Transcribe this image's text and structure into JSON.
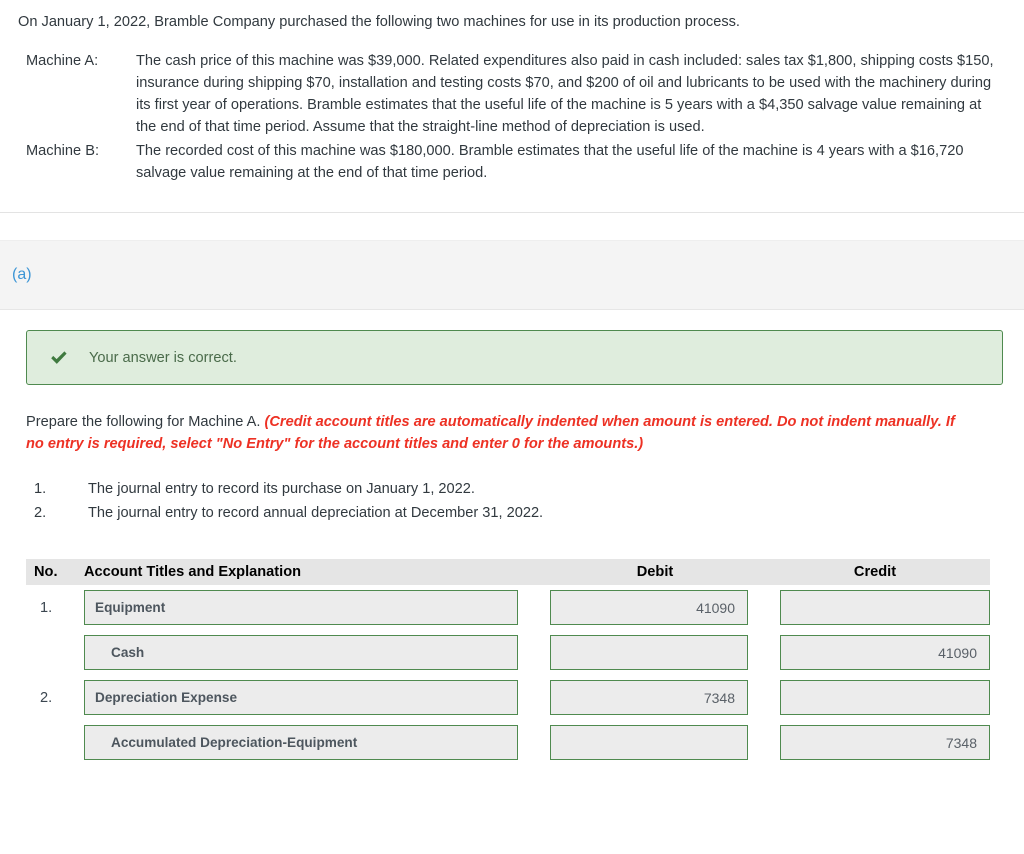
{
  "problem": {
    "intro": "On January 1, 2022, Bramble Company purchased the following two machines for use in its production process.",
    "machines": [
      {
        "label": "Machine A:",
        "text": "The cash price of this machine was $39,000. Related expenditures also paid in cash included: sales tax $1,800, shipping costs $150, insurance during shipping $70, installation and testing costs $70, and $200 of oil and lubricants to be used with the machinery during its first year of operations. Bramble estimates that the useful life of the machine is 5 years with a $4,350 salvage value remaining at the end of that time period. Assume that the straight-line method of depreciation is used."
      },
      {
        "label": "Machine B:",
        "text": "The recorded cost of this machine was $180,000. Bramble estimates that the useful life of the machine is 4 years with a $16,720 salvage value remaining at the end of that time period."
      }
    ]
  },
  "part": {
    "letter": "(a)"
  },
  "feedback": {
    "icon": "check-icon",
    "text": "Your answer is correct.",
    "border_color": "#4f8a4f",
    "background_color": "#dfeddd"
  },
  "instruction": {
    "lead": "Prepare the following for Machine A. ",
    "warning": "(Credit account titles are automatically indented when amount is entered. Do not indent manually. If no entry is required, select \"No Entry\" for the account titles and enter 0 for the amounts.)",
    "warning_color": "#ed3124"
  },
  "requirements": [
    {
      "num": "1.",
      "text": "The journal entry to record its purchase on January 1, 2022."
    },
    {
      "num": "2.",
      "text": "The journal entry to record annual depreciation at December 31, 2022."
    }
  ],
  "journal": {
    "headers": {
      "no": "No.",
      "account": "Account Titles and Explanation",
      "debit": "Debit",
      "credit": "Credit"
    },
    "rows": [
      {
        "no": "1.",
        "account": "Equipment",
        "indented": false,
        "debit": "41090",
        "credit": ""
      },
      {
        "no": "",
        "account": "Cash",
        "indented": true,
        "debit": "",
        "credit": "41090"
      },
      {
        "no": "2.",
        "account": "Depreciation Expense",
        "indented": false,
        "debit": "7348",
        "credit": ""
      },
      {
        "no": "",
        "account": "Accumulated Depreciation-Equipment",
        "indented": true,
        "debit": "",
        "credit": "7348"
      }
    ]
  }
}
